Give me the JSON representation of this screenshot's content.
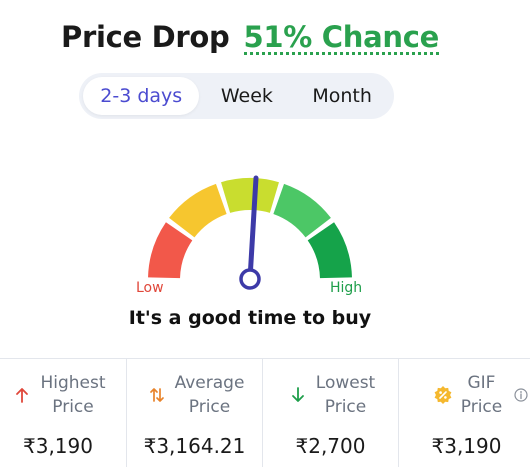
{
  "header": {
    "title": "Price Drop",
    "chance": "51% Chance"
  },
  "tabs": [
    {
      "label": "2-3 days",
      "active": true
    },
    {
      "label": "Week",
      "active": false
    },
    {
      "label": "Month",
      "active": false
    }
  ],
  "gauge": {
    "low_label": "Low",
    "high_label": "High",
    "segment_colors": [
      "#f2584a",
      "#f6c62f",
      "#c9dd2f",
      "#4cc766",
      "#15a34a"
    ],
    "needle_color": "#3d3aa8",
    "verdict": "It's a good time to buy"
  },
  "stats": [
    {
      "label_line1": "Highest",
      "label_line2": "Price",
      "value": "₹3,190",
      "icon": "arrow-up-icon"
    },
    {
      "label_line1": "Average",
      "label_line2": "Price",
      "value": "₹3,164.21",
      "icon": "swap-arrows-icon"
    },
    {
      "label_line1": "Lowest",
      "label_line2": "Price",
      "value": "₹2,700",
      "icon": "arrow-down-icon"
    },
    {
      "label_line1": "GIF",
      "label_line2": "Price",
      "value": "₹3,190",
      "icon": "discount-badge-icon"
    }
  ],
  "colors": {
    "accent": "#4b4bd0",
    "chance": "#2aa14e"
  }
}
